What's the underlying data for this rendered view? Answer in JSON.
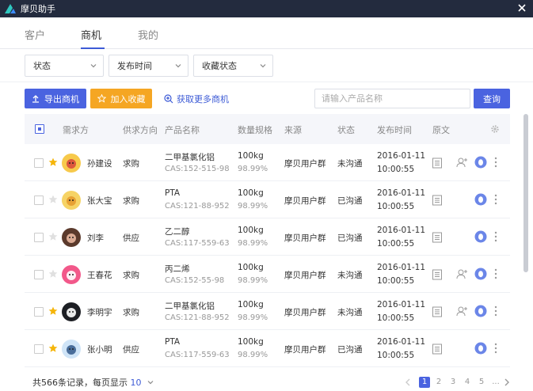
{
  "app": {
    "title": "摩贝助手"
  },
  "tabs": [
    {
      "label": "客户",
      "active": false
    },
    {
      "label": "商机",
      "active": true
    },
    {
      "label": "我的",
      "active": false
    }
  ],
  "filters": {
    "status": "状态",
    "publish_time": "发布时间",
    "fav_status": "收藏状态"
  },
  "actions": {
    "export_label": "导出商机",
    "fav_label": "加入收藏",
    "more_label": "获取更多商机",
    "search_placeholder": "请输入产品名称",
    "search_button": "查询"
  },
  "table": {
    "headers": {
      "demand": "需求方",
      "direction": "供求方向",
      "product": "产品名称",
      "qty": "数量规格",
      "source": "来源",
      "status": "状态",
      "time": "发布时间",
      "original": "原文"
    },
    "rows": [
      {
        "starred": true,
        "avatar": "avatar-1",
        "name": "孙建设",
        "direction": "求购",
        "product": "二甲基氯化铝",
        "cas": "CAS:152-515-98",
        "qty": "100kg",
        "purity": "98.99%",
        "source": "摩贝用户群",
        "status": "未沟通",
        "date": "2016-01-11",
        "time": "10:00:55",
        "add_user": true
      },
      {
        "starred": false,
        "avatar": "avatar-2",
        "name": "张大宝",
        "direction": "求购",
        "product": "PTA",
        "cas": "CAS:121-88-952",
        "qty": "100kg",
        "purity": "98.99%",
        "source": "摩贝用户群",
        "status": "已沟通",
        "date": "2016-01-11",
        "time": "10:00:55",
        "add_user": false
      },
      {
        "starred": false,
        "avatar": "avatar-3",
        "name": "刘李",
        "direction": "供应",
        "product": "乙二醇",
        "cas": "CAS:117-559-63",
        "qty": "100kg",
        "purity": "98.99%",
        "source": "摩贝用户群",
        "status": "已沟通",
        "date": "2016-01-11",
        "time": "10:00:55",
        "add_user": false
      },
      {
        "starred": false,
        "avatar": "avatar-4",
        "name": "王春花",
        "direction": "求购",
        "product": "丙二烯",
        "cas": "CAS:152-55-98",
        "qty": "100kg",
        "purity": "98.99%",
        "source": "摩贝用户群",
        "status": "未沟通",
        "date": "2016-01-11",
        "time": "10:00:55",
        "add_user": true
      },
      {
        "starred": true,
        "avatar": "avatar-5",
        "name": "李明宇",
        "direction": "求购",
        "product": "二甲基氯化铝",
        "cas": "CAS:121-88-952",
        "qty": "100kg",
        "purity": "98.99%",
        "source": "摩贝用户群",
        "status": "未沟通",
        "date": "2016-01-11",
        "time": "10:00:55",
        "add_user": true
      },
      {
        "starred": true,
        "avatar": "avatar-6",
        "name": "张小明",
        "direction": "供应",
        "product": "PTA",
        "cas": "CAS:117-559-63",
        "qty": "100kg",
        "purity": "98.99%",
        "source": "摩贝用户群",
        "status": "已沟通",
        "date": "2016-01-11",
        "time": "10:00:55",
        "add_user": false
      }
    ]
  },
  "footer": {
    "total_text": "共566条记录，每页显示",
    "page_size": "10",
    "pages": [
      "1",
      "2",
      "3",
      "4",
      "5",
      "..."
    ],
    "current_page": "1"
  },
  "colors": {
    "primary": "#4a63e0",
    "accent": "#f5a623",
    "titlebar": "#232b3e",
    "qq": "#6b86e8"
  }
}
